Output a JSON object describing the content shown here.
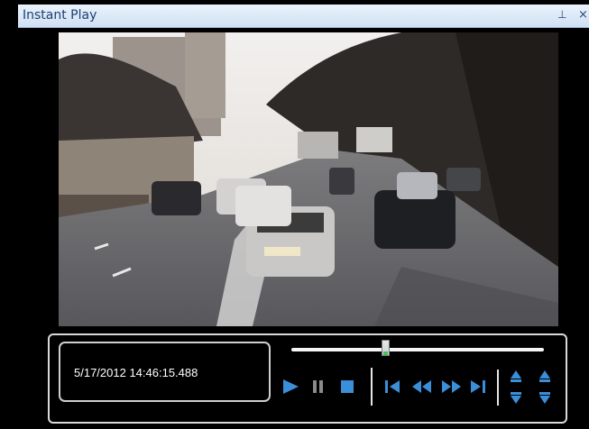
{
  "window": {
    "title": "Instant Play",
    "pin_glyph": "⊥",
    "close_glyph": "×"
  },
  "video": {
    "description_icon": "video-frame"
  },
  "player": {
    "timestamp": "5/17/2012 14:46:15.488",
    "position_fraction": 0.37,
    "accent_color": "#3b8fd9"
  }
}
